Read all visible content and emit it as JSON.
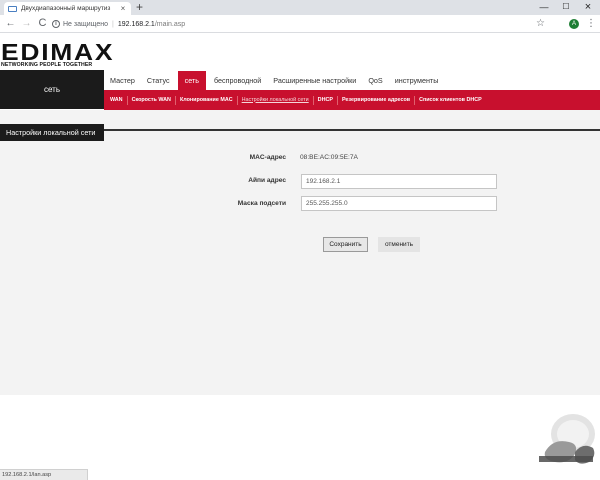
{
  "browser": {
    "tab_title": "Двухдиапазонный маршрутиз",
    "tab_close": "×",
    "new_tab": "+",
    "win_min": "—",
    "win_max": "☐",
    "win_close": "×",
    "back": "←",
    "forward": "→",
    "reload": "C",
    "info": "i",
    "insecure_label": "Не защищено",
    "separator": "|",
    "url_host": "192.168.2.1",
    "url_path": "/main.asp",
    "star": "☆",
    "avatar_letter": "A",
    "menu": "⋮",
    "status_url": "192.168.2.1/lan.asp"
  },
  "brand": {
    "logo_text": "EDIMAX",
    "tagline": "NETWORKING PEOPLE TOGETHER"
  },
  "sidebar": {
    "title": "сеть",
    "section": "Настройки локальной сети"
  },
  "main_nav": [
    {
      "label": "Мастер",
      "active": false
    },
    {
      "label": "Статус",
      "active": false
    },
    {
      "label": "сеть",
      "active": true
    },
    {
      "label": "беспроводной",
      "active": false
    },
    {
      "label": "Расширенные настройки",
      "active": false
    },
    {
      "label": "QoS",
      "active": false
    },
    {
      "label": "инструменты",
      "active": false
    }
  ],
  "sub_nav": [
    {
      "label": "WAN",
      "active": false
    },
    {
      "label": "Скорость WAN",
      "active": false
    },
    {
      "label": "Клонирование MAC",
      "active": false
    },
    {
      "label": "Настройки локальной сети",
      "active": true
    },
    {
      "label": "DHCP",
      "active": false
    },
    {
      "label": "Резервирование адресов",
      "active": false
    },
    {
      "label": "Список клиентов DHCP",
      "active": false
    }
  ],
  "form": {
    "mac_label": "MAC-адрес",
    "mac_value": "08:BE:AC:09:5E:7A",
    "ip_label": "Айпи адрес",
    "ip_value": "192.168.2.1",
    "mask_label": "Маска подсети",
    "mask_value": "255.255.255.0"
  },
  "buttons": {
    "save": "Сохранить",
    "cancel": "отменить"
  },
  "colors": {
    "accent_red": "#c8102e",
    "dark_panel": "#1b1b1b"
  }
}
